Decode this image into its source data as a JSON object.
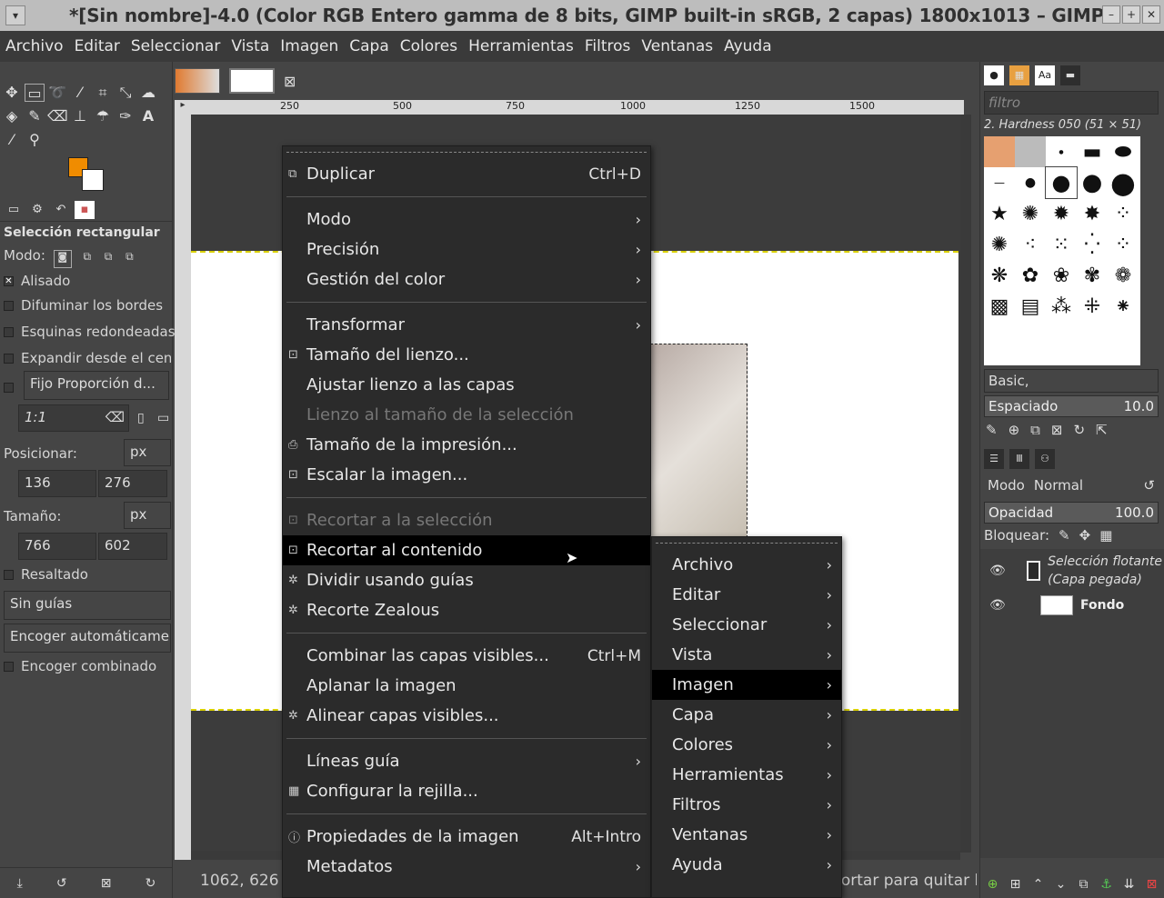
{
  "window": {
    "title": "*[Sin nombre]-4.0 (Color RGB Entero gamma de 8 bits, GIMP built-in sRGB, 2 capas) 1800x1013 – GIMP"
  },
  "menubar": [
    "Archivo",
    "Editar",
    "Seleccionar",
    "Vista",
    "Imagen",
    "Capa",
    "Colores",
    "Herramientas",
    "Filtros",
    "Ventanas",
    "Ayuda"
  ],
  "colors": {
    "foreground": "#f08c00",
    "background": "#ffffff",
    "selection_outline": "#d9d000"
  },
  "tool_options": {
    "title": "Selección rectangular",
    "mode_label": "Modo:",
    "antialias": "Alisado",
    "feather": "Difuminar los bordes",
    "rounded": "Esquinas redondeadas",
    "expand": "Expandir desde el centro",
    "fixed": "Fijo  Proporción d...",
    "ratio": "1:1",
    "position_label": "Posicionar:",
    "position_unit": "px",
    "pos_x": "136",
    "pos_y": "276",
    "size_label": "Tamaño:",
    "size_unit": "px",
    "size_w": "766",
    "size_h": "602",
    "highlight": "Resaltado",
    "guides": "Sin guías",
    "autoshrink": "Encoger automáticamente",
    "shrink_merged": "Encoger combinado"
  },
  "ruler": {
    "h_ticks": [
      "250",
      "500",
      "750",
      "1000",
      "1250",
      "1500"
    ]
  },
  "status": {
    "coords": "1062, 626",
    "hint": "Recortar para quitar los bordes v..."
  },
  "brushes": {
    "filter_placeholder": "filtro",
    "current": "2. Hardness 050 (51 × 51)",
    "set": "Basic,",
    "spacing_label": "Espaciado",
    "spacing_value": "10.0"
  },
  "layers": {
    "mode_label": "Modo",
    "mode_value": "Normal",
    "opacity_label": "Opacidad",
    "opacity_value": "100.0",
    "lock_label": "Bloquear:",
    "items": [
      {
        "name": "Selección flotante",
        "sub": "(Capa pegada)"
      },
      {
        "name": "Fondo"
      }
    ]
  },
  "image_menu": {
    "items": [
      {
        "label": "Duplicar",
        "accel": "Ctrl+D",
        "icon": "duplicate-icon"
      },
      {
        "sep": true
      },
      {
        "label": "Modo",
        "submenu": true
      },
      {
        "label": "Precisión",
        "submenu": true
      },
      {
        "label": "Gestión del color",
        "submenu": true
      },
      {
        "sep": true
      },
      {
        "label": "Transformar",
        "submenu": true
      },
      {
        "label": "Tamaño del lienzo...",
        "icon": "canvas-size-icon"
      },
      {
        "label": "Ajustar lienzo a las capas"
      },
      {
        "label": "Lienzo al tamaño de la selección",
        "disabled": true
      },
      {
        "label": "Tamaño de la impresión...",
        "icon": "print-size-icon"
      },
      {
        "label": "Escalar la imagen...",
        "icon": "scale-icon"
      },
      {
        "sep": true
      },
      {
        "label": "Recortar a la selección",
        "disabled": true,
        "icon": "crop-icon"
      },
      {
        "label": "Recortar al contenido",
        "highlight": true,
        "icon": "crop-icon"
      },
      {
        "label": "Dividir usando guías",
        "icon": "plugin-icon"
      },
      {
        "label": "Recorte Zealous",
        "icon": "plugin-icon"
      },
      {
        "sep": true
      },
      {
        "label": "Combinar las capas visibles...",
        "accel": "Ctrl+M"
      },
      {
        "label": "Aplanar la imagen"
      },
      {
        "label": "Alinear capas visibles...",
        "icon": "plugin-icon"
      },
      {
        "sep": true
      },
      {
        "label": "Líneas guía",
        "submenu": true
      },
      {
        "label": "Configurar la rejilla...",
        "icon": "grid-icon"
      },
      {
        "sep": true
      },
      {
        "label": "Propiedades de la imagen",
        "accel": "Alt+Intro",
        "icon": "info-icon"
      },
      {
        "label": "Metadatos",
        "submenu": true
      }
    ]
  },
  "context_menu": {
    "items": [
      {
        "label": "Archivo"
      },
      {
        "label": "Editar"
      },
      {
        "label": "Seleccionar"
      },
      {
        "label": "Vista"
      },
      {
        "label": "Imagen",
        "highlight": true
      },
      {
        "label": "Capa"
      },
      {
        "label": "Colores"
      },
      {
        "label": "Herramientas"
      },
      {
        "label": "Filtros"
      },
      {
        "label": "Ventanas"
      },
      {
        "label": "Ayuda"
      }
    ]
  }
}
